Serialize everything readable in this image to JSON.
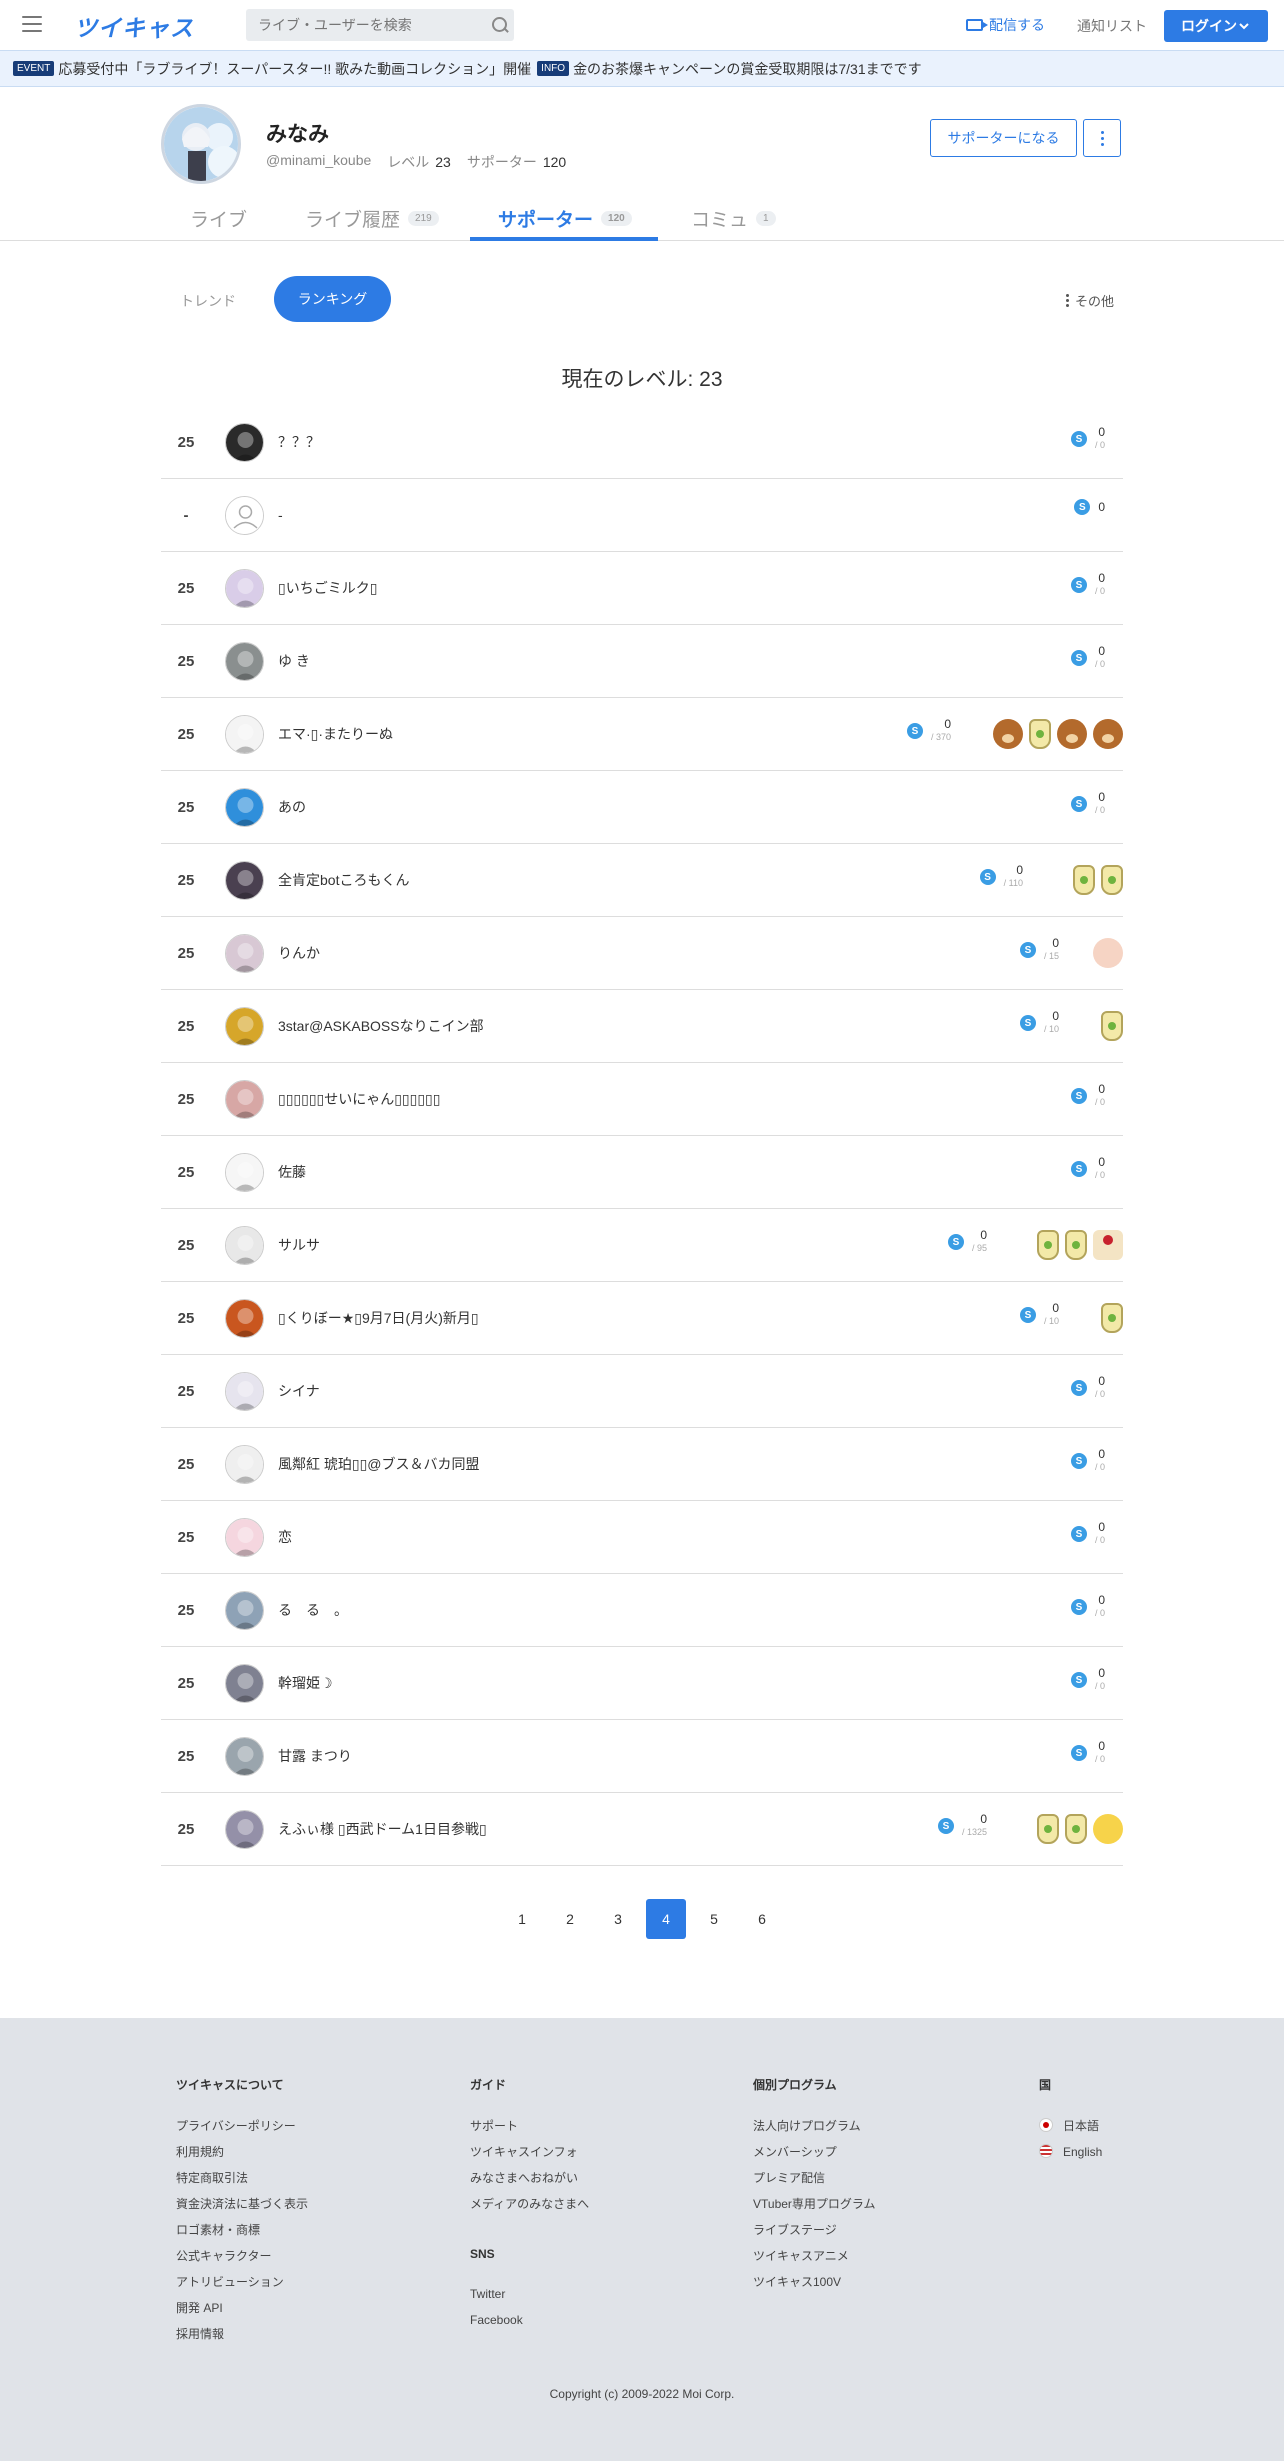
{
  "header": {
    "logo": "ツイキャス",
    "search_placeholder": "ライブ・ユーザーを検索",
    "broadcast": "配信する",
    "notifications": "通知リスト",
    "login": "ログイン"
  },
  "ticker": {
    "event_tag": "EVENT",
    "event_text": "応募受付中「ラブライブ！スーパースター!! 歌みた動画コレクション」開催",
    "info_tag": "INFO",
    "info_text": "金のお茶爆キャンペーンの賞金受取期限は7/31までです"
  },
  "profile": {
    "name": "みなみ",
    "handle": "@minami_koube",
    "level_label": "レベル",
    "level": "23",
    "supporter_label": "サポーター",
    "supporters": "120",
    "support_button": "サポーターになる"
  },
  "tabs": [
    {
      "label": "ライブ",
      "count": ""
    },
    {
      "label": "ライブ履歴",
      "count": "219"
    },
    {
      "label": "サポーター",
      "count": "120"
    },
    {
      "label": "コミュ",
      "count": "1"
    }
  ],
  "filters": {
    "trend": "トレンド",
    "ranking": "ランキング",
    "other": "その他"
  },
  "current_level": "現在のレベル: 23",
  "rows": [
    {
      "rank": "25",
      "name": "？？？",
      "score": "0",
      "max": "/ 0",
      "gifts": [],
      "av": "#2a2a2a"
    },
    {
      "rank": "-",
      "name": "-",
      "score": "0",
      "max": "",
      "gifts": [],
      "av": "default"
    },
    {
      "rank": "25",
      "name": "▯いちごミルク▯",
      "score": "0",
      "max": "/ 0",
      "gifts": [],
      "av": "#d9cde8"
    },
    {
      "rank": "25",
      "name": "ゆ き",
      "score": "0",
      "max": "/ 0",
      "gifts": [],
      "av": "#8a8f8f"
    },
    {
      "rank": "25",
      "name": "エマ·▯·またりーぬ",
      "score": "0",
      "max": "/ 370",
      "gifts": [
        "bear",
        "soda",
        "bear",
        "bear"
      ],
      "av": "#f4f4f4"
    },
    {
      "rank": "25",
      "name": "あの",
      "score": "0",
      "max": "/ 0",
      "gifts": [],
      "av": "#2f8fdb"
    },
    {
      "rank": "25",
      "name": "全肯定botころもくん",
      "score": "0",
      "max": "/ 110",
      "gifts": [
        "soda",
        "soda"
      ],
      "av": "#4a4050"
    },
    {
      "rank": "25",
      "name": "りんか",
      "score": "0",
      "max": "/ 15",
      "gifts": [
        "hand"
      ],
      "av": "#d8c8d4"
    },
    {
      "rank": "25",
      "name": "3star@ASKABOSSなりこイン部",
      "score": "0",
      "max": "/ 10",
      "gifts": [
        "soda"
      ],
      "av": "#d6a62a"
    },
    {
      "rank": "25",
      "name": "▯▯▯▯▯▯せいにゃん▯▯▯▯▯▯",
      "score": "0",
      "max": "/ 0",
      "gifts": [],
      "av": "#d7a7a5"
    },
    {
      "rank": "25",
      "name": "佐藤",
      "score": "0",
      "max": "/ 0",
      "gifts": [],
      "av": "#f6f6f6"
    },
    {
      "rank": "25",
      "name": "サルサ",
      "score": "0",
      "max": "/ 95",
      "gifts": [
        "soda",
        "soda",
        "cake"
      ],
      "av": "#e8e8e8"
    },
    {
      "rank": "25",
      "name": "▯くりぼー★▯9月7日(月火)新月▯",
      "score": "0",
      "max": "/ 10",
      "gifts": [
        "soda"
      ],
      "av": "#c9561f"
    },
    {
      "rank": "25",
      "name": "シイナ",
      "score": "0",
      "max": "/ 0",
      "gifts": [],
      "av": "#e6e4ee"
    },
    {
      "rank": "25",
      "name": "風鄰紅 琥珀▯▯@ブス＆バカ同盟",
      "score": "0",
      "max": "/ 0",
      "gifts": [],
      "av": "#efefef"
    },
    {
      "rank": "25",
      "name": "恋",
      "score": "0",
      "max": "/ 0",
      "gifts": [],
      "av": "#f5d6df"
    },
    {
      "rank": "25",
      "name": "る　る　。",
      "score": "0",
      "max": "/ 0",
      "gifts": [],
      "av": "#8ea2b6"
    },
    {
      "rank": "25",
      "name": "幹瑠姫☽",
      "score": "0",
      "max": "/ 0",
      "gifts": [],
      "av": "#7f8191"
    },
    {
      "rank": "25",
      "name": "甘露 まつり",
      "score": "0",
      "max": "/ 0",
      "gifts": [],
      "av": "#9aa5ad"
    },
    {
      "rank": "25",
      "name": "えふぃ様 ▯西武ドーム1日目参戦▯",
      "score": "0",
      "max": "/ 1325",
      "gifts": [
        "soda",
        "soda",
        "sun"
      ],
      "av": "#9490a8"
    }
  ],
  "pager": [
    "1",
    "2",
    "3",
    "4",
    "5",
    "6"
  ],
  "footer": {
    "about": {
      "title": "ツイキャスについて",
      "links": [
        "プライバシーポリシー",
        "利用規約",
        "特定商取引法",
        "資金決済法に基づく表示",
        "ロゴ素材・商標",
        "公式キャラクター",
        "アトリビューション",
        "開発 API",
        "採用情報"
      ]
    },
    "guide": {
      "title": "ガイド",
      "links": [
        "サポート",
        "ツイキャスインフォ",
        "みなさまへおねがい",
        "メディアのみなさまへ"
      ]
    },
    "sns": {
      "title": "SNS",
      "links": [
        "Twitter",
        "Facebook"
      ]
    },
    "programs": {
      "title": "個別プログラム",
      "links": [
        "法人向けプログラム",
        "メンバーシップ",
        "プレミア配信",
        "VTuber専用プログラム",
        "ライブステージ",
        "ツイキャスアニメ",
        "ツイキャス100V"
      ]
    },
    "country": {
      "title": "国",
      "links": [
        "日本語",
        "English"
      ]
    },
    "copyright": "Copyright (c) 2009-2022 Moi Corp."
  }
}
